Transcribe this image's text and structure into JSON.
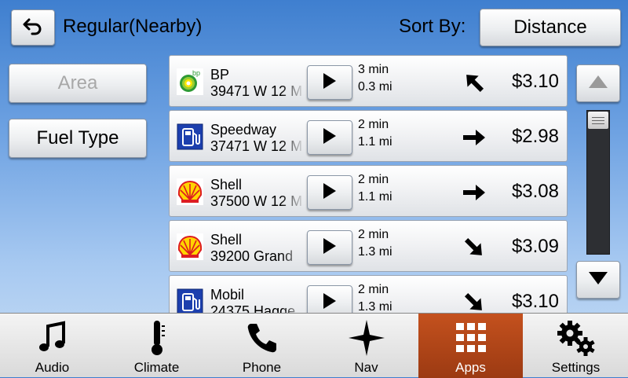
{
  "header": {
    "title": "Regular(Nearby)",
    "sort_label": "Sort By:",
    "sort_value": "Distance"
  },
  "filters": {
    "area_label": "Area",
    "fuel_type_label": "Fuel Type"
  },
  "stations": [
    {
      "name": "BP",
      "address": "39471 W 12 M",
      "time": "3 min",
      "distance": "0.3 mi",
      "price": "$3.10",
      "direction": "up-left",
      "brand": "bp"
    },
    {
      "name": "Speedway",
      "address": "37471 W 12 M",
      "time": "2 min",
      "distance": "1.1 mi",
      "price": "$2.98",
      "direction": "right",
      "brand": "generic"
    },
    {
      "name": "Shell",
      "address": "37500 W 12 M",
      "time": "2 min",
      "distance": "1.1 mi",
      "price": "$3.08",
      "direction": "right",
      "brand": "shell"
    },
    {
      "name": "Shell",
      "address": "39200 Grand",
      "time": "2 min",
      "distance": "1.3 mi",
      "price": "$3.09",
      "direction": "down-right",
      "brand": "shell"
    },
    {
      "name": "Mobil",
      "address": "24375 Hagge",
      "time": "2 min",
      "distance": "1.3 mi",
      "price": "$3.10",
      "direction": "down-right",
      "brand": "generic"
    }
  ],
  "nav": [
    {
      "label": "Audio",
      "icon": "music-note-icon"
    },
    {
      "label": "Climate",
      "icon": "thermometer-icon"
    },
    {
      "label": "Phone",
      "icon": "phone-icon"
    },
    {
      "label": "Nav",
      "icon": "compass-star-icon"
    },
    {
      "label": "Apps",
      "icon": "apps-grid-icon",
      "active": true
    },
    {
      "label": "Settings",
      "icon": "gears-icon"
    }
  ],
  "colors": {
    "active_tab": "#b4491a",
    "background_top": "#3f7fcf",
    "background_bottom": "#c9def5",
    "fuel_icon_blue": "#1c3fae",
    "shell_yellow": "#ffd500",
    "shell_red": "#dd1d21",
    "bp_green": "#2e9a34"
  }
}
